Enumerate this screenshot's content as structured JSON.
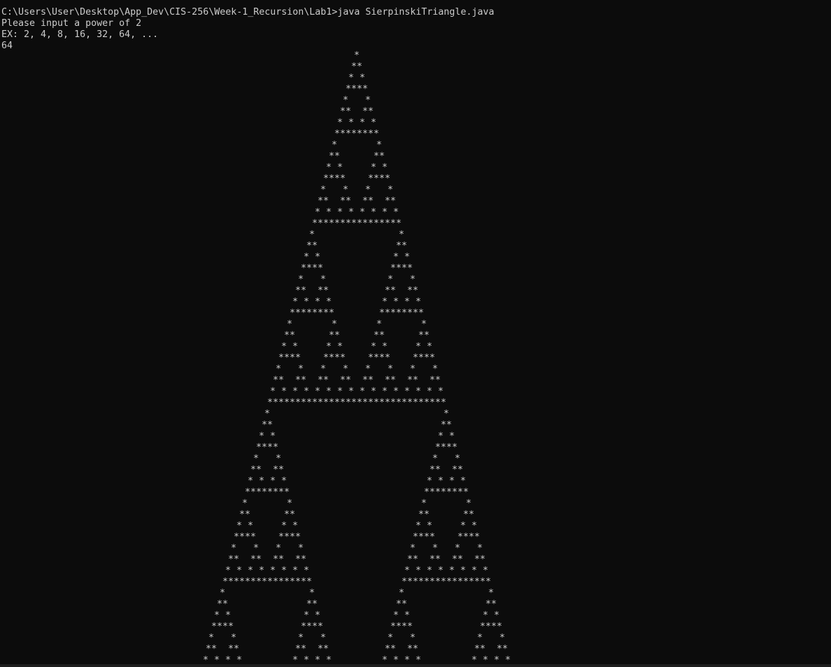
{
  "console": {
    "command_line": "C:\\Users\\User\\Desktop\\App_Dev\\CIS-256\\Week-1_Recursion\\Lab1>java SierpinskiTriangle.java",
    "prompt_line": "Please input a power of 2",
    "example_line": "EX: 2, 4, 8, 16, 32, 64, ...",
    "user_input": "64"
  },
  "triangle": {
    "order": 64,
    "glyph": "*",
    "color": "#cccccc"
  },
  "colors": {
    "background": "#0c0c0c",
    "text": "#cccccc"
  }
}
